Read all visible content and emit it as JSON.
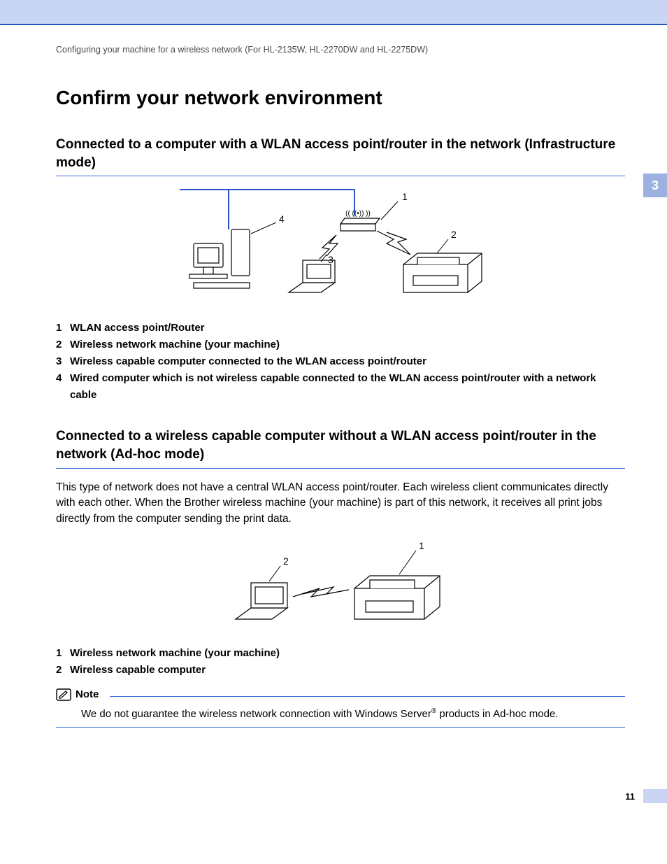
{
  "runningHeader": "Configuring your machine for a wireless network (For HL-2135W, HL-2270DW and HL-2275DW)",
  "chapterTab": "3",
  "pageNumber": "11",
  "title": "Confirm your network environment",
  "section1": {
    "heading": "Connected to a computer with a WLAN access point/router in the network (Infrastructure mode)",
    "fig": {
      "l1": "1",
      "l2": "2",
      "l3": "3",
      "l4": "4"
    },
    "legend": [
      {
        "n": "1",
        "t": "WLAN access point/Router"
      },
      {
        "n": "2",
        "t": "Wireless network machine (your machine)"
      },
      {
        "n": "3",
        "t": "Wireless capable computer connected to the WLAN access point/router"
      },
      {
        "n": "4",
        "t": "Wired computer which is not wireless capable connected to the WLAN access point/router with a network cable"
      }
    ]
  },
  "section2": {
    "heading": "Connected to a wireless capable computer without a WLAN access point/router in the network (Ad-hoc mode)",
    "paragraph": "This type of network does not have a central WLAN access point/router. Each wireless client communicates directly with each other. When the Brother wireless machine (your machine) is part of this network, it receives all print jobs directly from the computer sending the print data.",
    "fig": {
      "l1": "1",
      "l2": "2"
    },
    "legend": [
      {
        "n": "1",
        "t": "Wireless network machine (your machine)"
      },
      {
        "n": "2",
        "t": "Wireless capable computer"
      }
    ]
  },
  "note": {
    "label": "Note",
    "body_pre": "We do not guarantee the wireless network connection with Windows Server",
    "body_sup": "®",
    "body_post": " products in Ad-hoc mode."
  }
}
